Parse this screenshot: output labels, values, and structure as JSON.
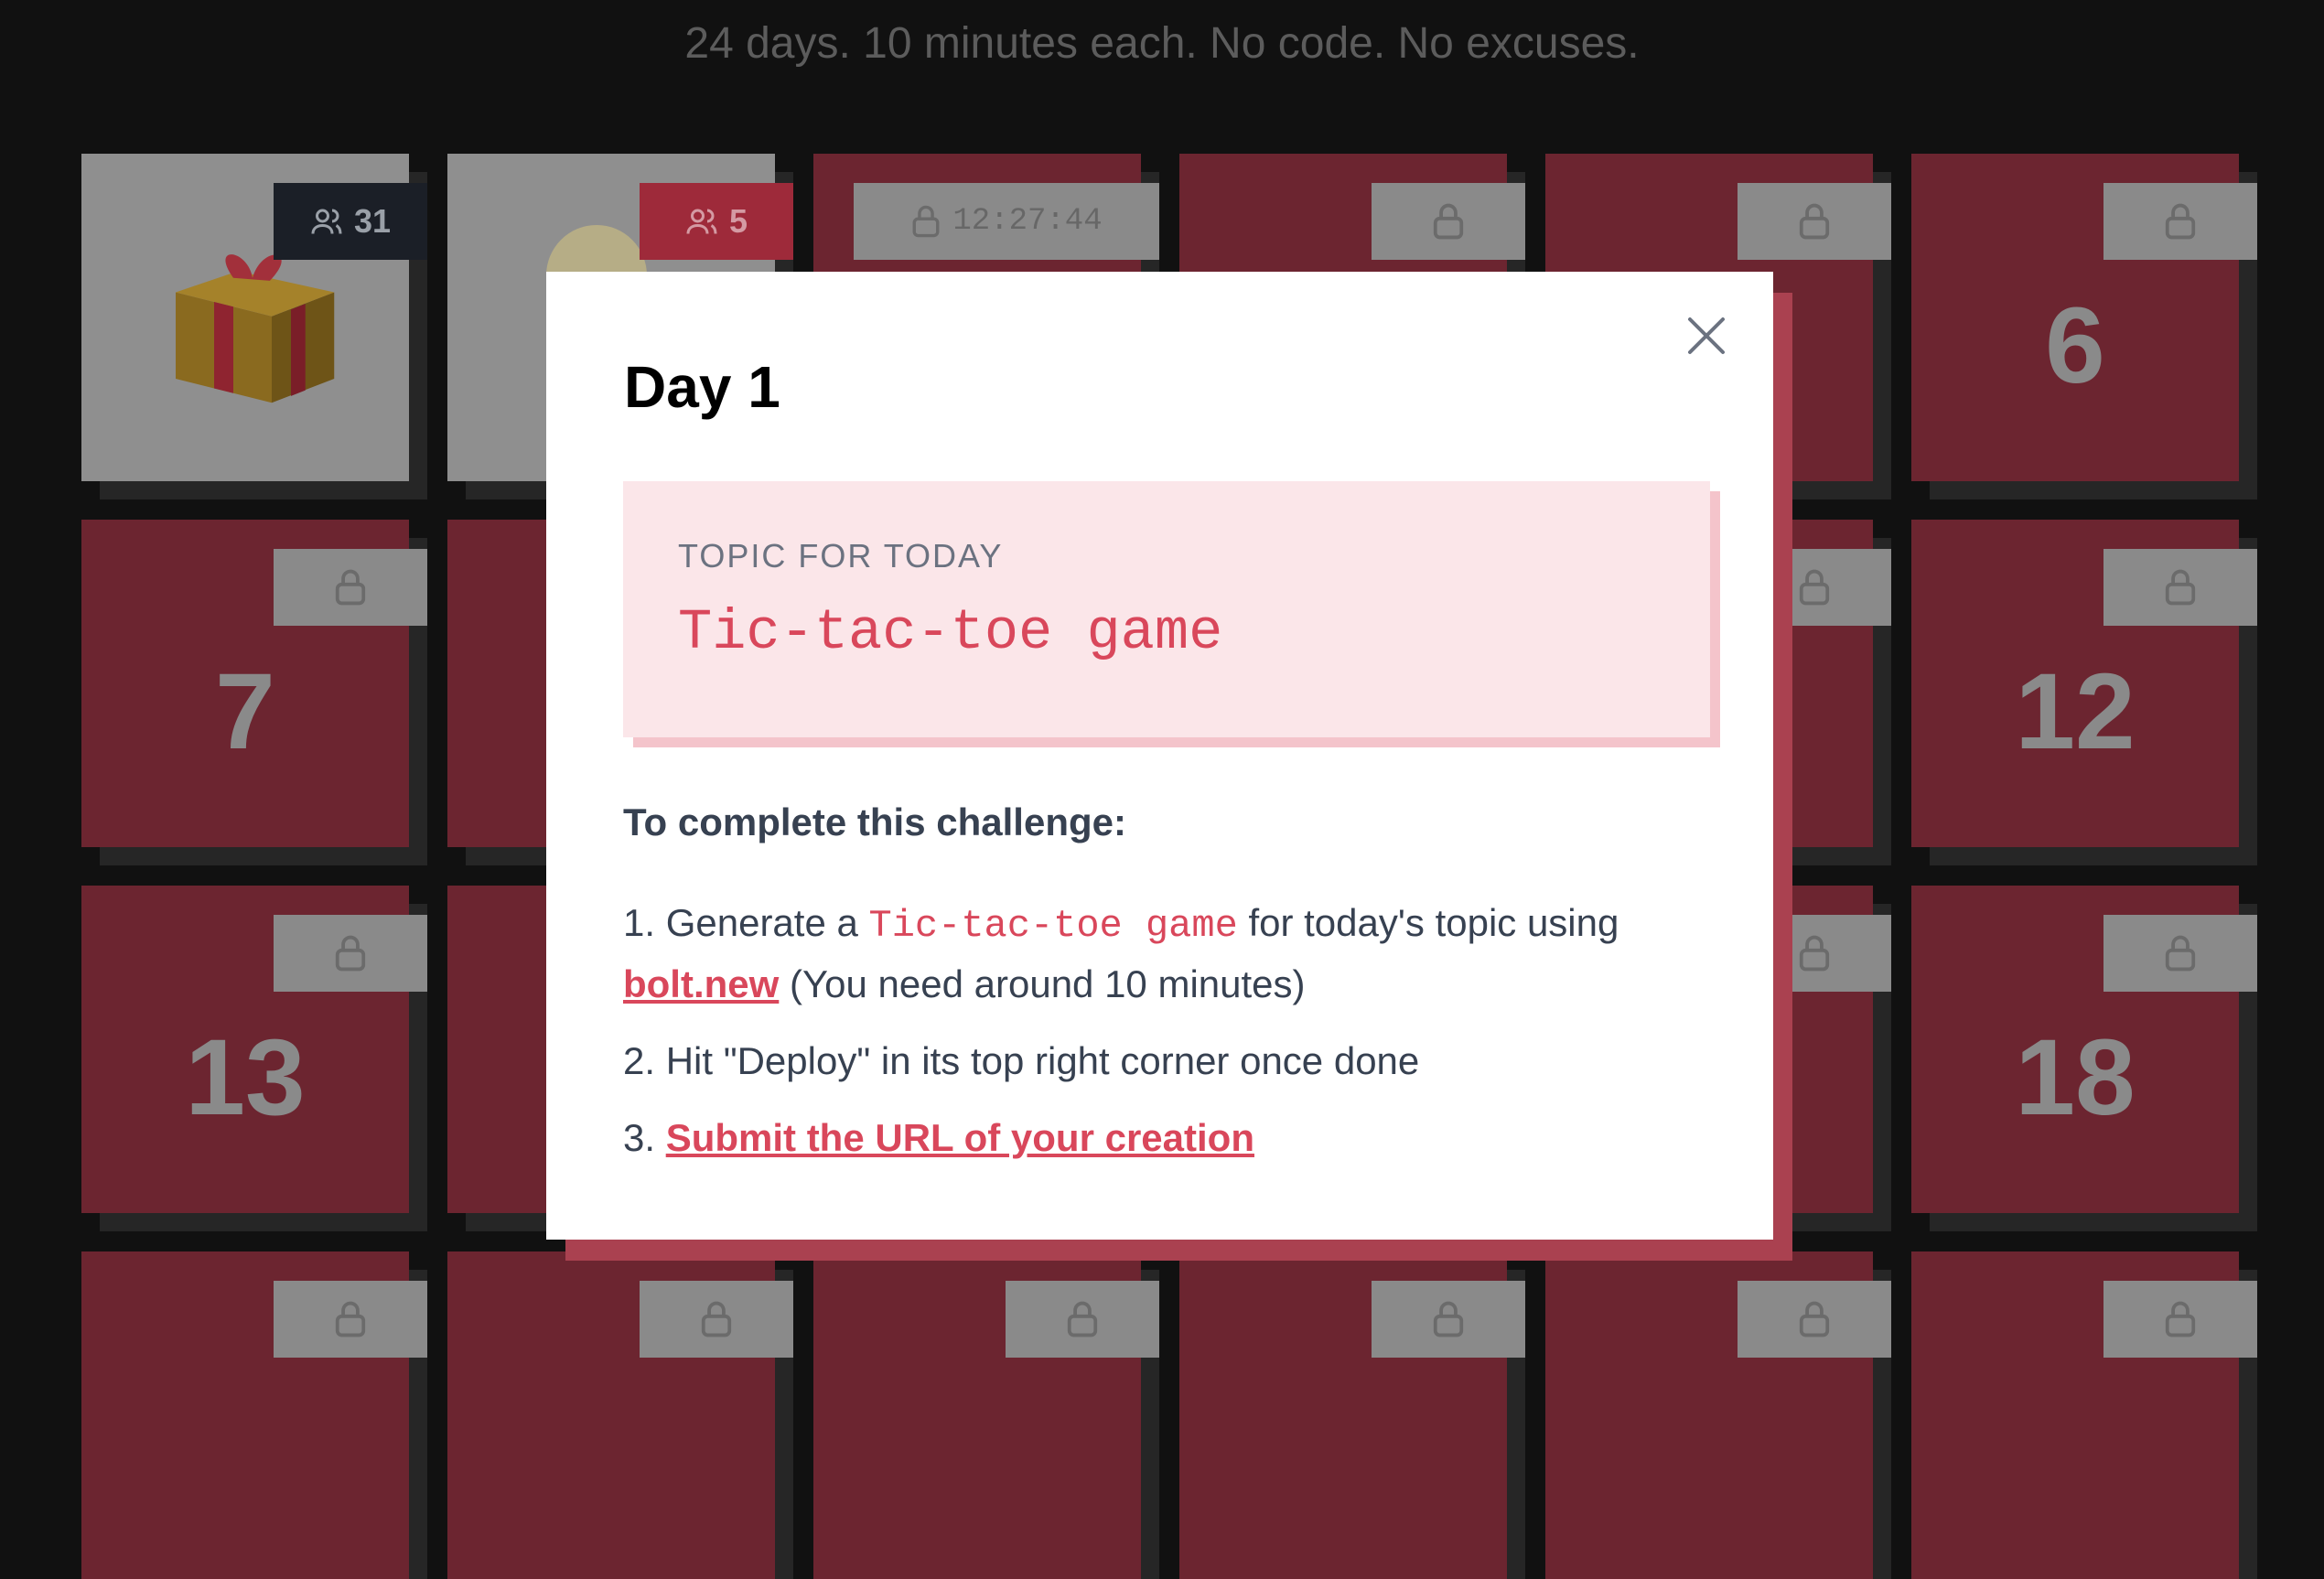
{
  "header": {
    "tagline": "24 days. 10 minutes each. No code. No excuses."
  },
  "calendar": {
    "day1": {
      "participants": "31"
    },
    "day2": {
      "participants": "5"
    },
    "day3": {
      "countdown": "12:27:44"
    },
    "visible_numbers": {
      "d6": "6",
      "d7": "7",
      "d12": "12",
      "d13": "13",
      "d18": "18"
    }
  },
  "modal": {
    "title": "Day 1",
    "topic_label": "TOPIC FOR TODAY",
    "topic": "Tic-tac-toe game",
    "instructions_title": "To complete this challenge:",
    "step1": {
      "prefix": "1. Generate a ",
      "topic": "Tic-tac-toe game",
      "middle": " for today's topic using ",
      "link": "bolt.new",
      "suffix": " (You need around 10 minutes)"
    },
    "step2": "2. Hit \"Deploy\" in its top right corner once done",
    "step3": {
      "prefix": "3. ",
      "link": "Submit the URL of your creation"
    }
  },
  "colors": {
    "background": "#111111",
    "locked_tile": "#6c2530",
    "accent": "#d9475b",
    "topic_bg": "#fbe6e9"
  },
  "icons": {
    "lock": "lock-icon",
    "users": "users-icon",
    "close": "close-icon",
    "gift": "gift-icon"
  }
}
